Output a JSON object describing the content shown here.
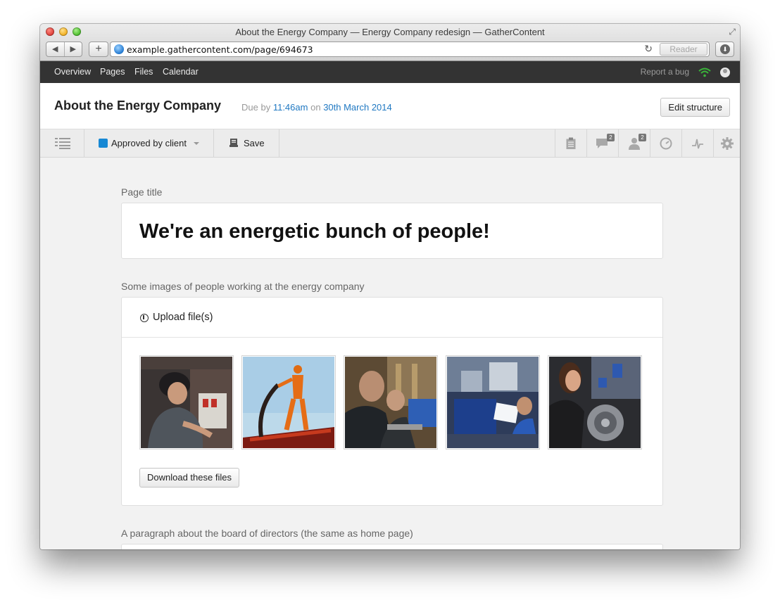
{
  "window": {
    "title": "About the Energy Company — Energy Company redesign — GatherContent",
    "url": "example.gathercontent.com/page/694673",
    "reader_label": "Reader",
    "nav_back": "◀",
    "nav_forward": "▶",
    "add_tab": "+",
    "reload": "↻"
  },
  "topnav": {
    "items": [
      "Overview",
      "Pages",
      "Files",
      "Calendar"
    ],
    "report_bug": "Report a bug"
  },
  "page": {
    "title": "About the Energy Company",
    "due_prefix": "Due by",
    "due_time": "11:46am",
    "due_on": "on",
    "due_date": "30th March 2014",
    "edit_structure": "Edit structure"
  },
  "toolbar": {
    "status_label": "Approved by client",
    "status_color": "#1788d4",
    "save_label": "Save",
    "comments_count": "2",
    "people_count": "2",
    "icons": [
      "list-icon",
      "clipboard-icon",
      "comment-icon",
      "person-icon",
      "clock-icon",
      "activity-icon",
      "gear-icon"
    ]
  },
  "fields": {
    "page_title_label": "Page title",
    "page_title_value": "We're an energetic bunch of people!",
    "images_label": "Some images of people working at the energy company",
    "upload_label": "Upload file(s)",
    "download_label": "Download these files",
    "paragraph_label": "A paragraph about the board of directors (the same as home page)"
  },
  "accent_link_color": "#1f78c2",
  "nav_bg_color": "#333333"
}
